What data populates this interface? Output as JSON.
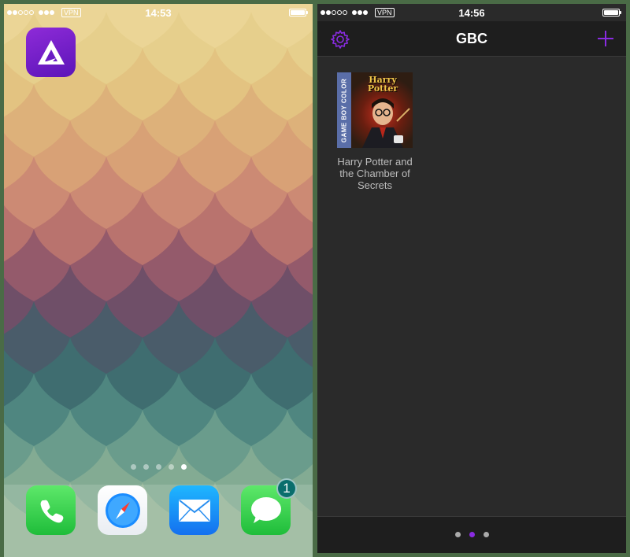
{
  "left_screen": {
    "status": {
      "time": "14:53",
      "vpn": "VPN"
    },
    "apps": {
      "delta": "delta-app-icon"
    },
    "page_dots": {
      "count": 5,
      "active": 4
    },
    "dock": [
      {
        "icon": "phone-icon"
      },
      {
        "icon": "safari-icon"
      },
      {
        "icon": "mail-icon"
      },
      {
        "icon": "messages-icon",
        "badge": "1"
      }
    ]
  },
  "right_screen": {
    "status": {
      "time": "14:56",
      "vpn": "VPN"
    },
    "navbar": {
      "title": "GBC",
      "accent": "#8a2be2"
    },
    "games": [
      {
        "title": "Harry Potter and the Chamber of Secrets",
        "cover_spine": "GAME BOY COLOR",
        "cover_title": "Harry Potter"
      }
    ],
    "page_dots": {
      "count": 3,
      "active": 1
    }
  }
}
